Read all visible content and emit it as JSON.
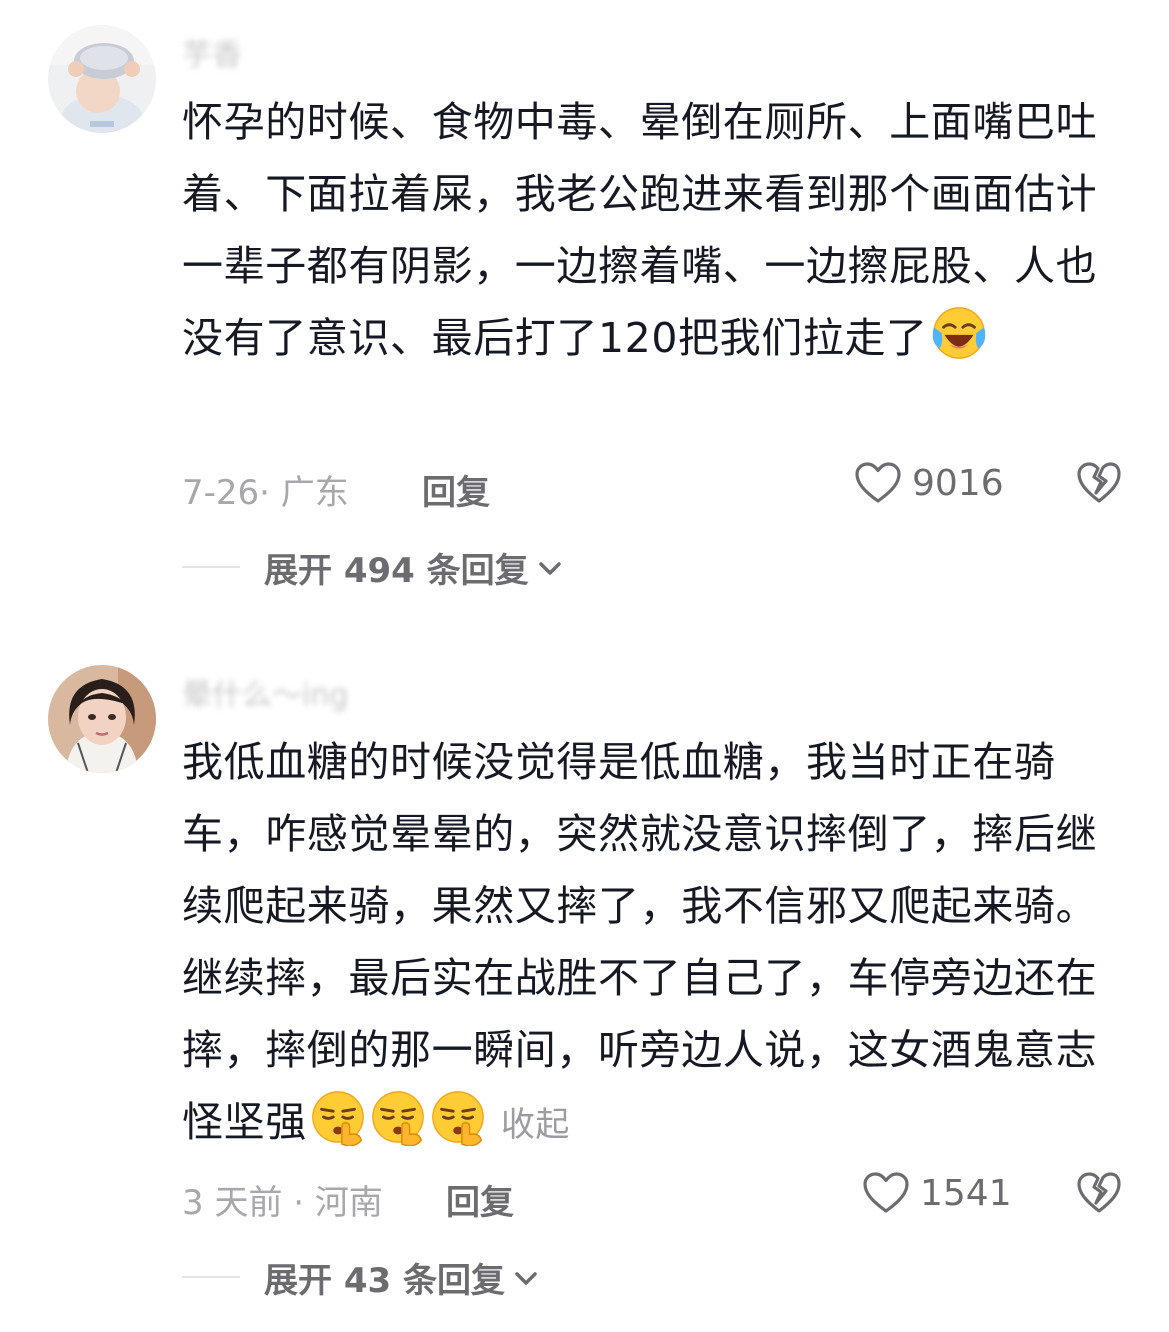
{
  "comments": [
    {
      "username": "芋香",
      "text": "怀孕的时候、食物中毒、晕倒在厕所、上面嘴巴吐着、下面拉着屎，我老公跑进来看到那个画面估计一辈子都有阴影，一边擦着嘴、一边擦屁股、人也没有了意识、最后打了120把我们拉走了",
      "emoji_count": 1,
      "emoji_icon": "laughing-crying-emoji-icon",
      "collapse_label": "",
      "date_location": "7-26· 广东",
      "reply_label": "回复",
      "like_count": "9016",
      "expand_label": "展开 494 条回复"
    },
    {
      "username": "晕什么～ing",
      "text": "我低血糖的时候没觉得是低血糖，我当时正在骑车，咋感觉晕晕的，突然就没意识摔倒了，摔后继续爬起来骑，果然又摔了，我不信邪又爬起来骑。继续摔，最后实在战胜不了自己了，车停旁边还在摔，摔倒的那一瞬间，听旁边人说，这女酒鬼意志怪坚强",
      "emoji_count": 3,
      "emoji_icon": "shushing-face-emoji-icon",
      "collapse_label": "收起",
      "date_location": "3 天前 · 河南",
      "reply_label": "回复",
      "like_count": "1541",
      "expand_label": "展开 43 条回复"
    }
  ],
  "colors": {
    "text_primary": "#161823",
    "text_secondary": "#a7a7ac",
    "action_gray": "#6b6b70",
    "divider": "#e3e3e6"
  }
}
